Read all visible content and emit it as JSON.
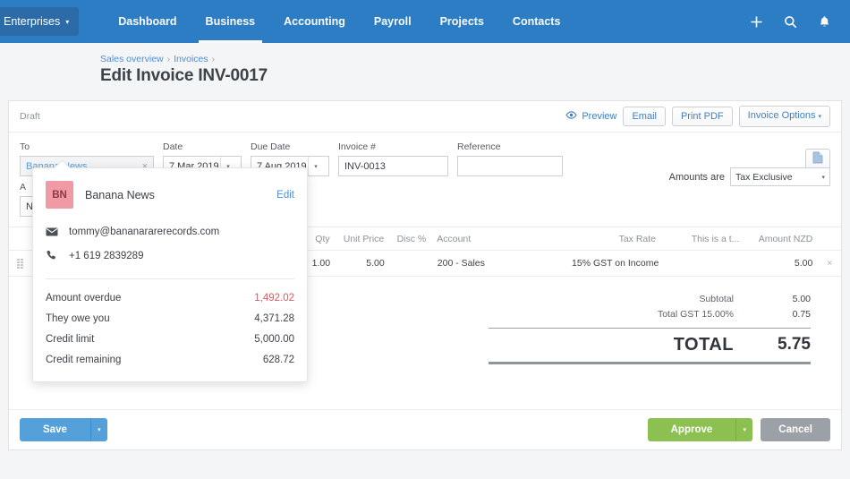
{
  "topnav": {
    "org": "Enterprises",
    "org_caret": "▾",
    "items": [
      {
        "label": "Dashboard",
        "active": false
      },
      {
        "label": "Business",
        "active": true
      },
      {
        "label": "Accounting",
        "active": false
      },
      {
        "label": "Payroll",
        "active": false
      },
      {
        "label": "Projects",
        "active": false
      },
      {
        "label": "Contacts",
        "active": false
      }
    ],
    "icons": [
      "plus-icon",
      "search-icon",
      "bell-icon"
    ]
  },
  "breadcrumb": {
    "item1": "Sales overview",
    "sep1": "›",
    "item2": "Invoices",
    "sep2": "›"
  },
  "page_title": "Edit Invoice INV-0017",
  "toolbar": {
    "status": "Draft",
    "preview": "Preview",
    "email": "Email",
    "print_pdf": "Print PDF",
    "invoice_options": "Invoice Options",
    "caret": "▾"
  },
  "form": {
    "to_label": "To",
    "to_value": "Banana News",
    "to_clear": "×",
    "date_label": "Date",
    "date_value": "7 Mar 2019",
    "due_label": "Due Date",
    "due_value": "7 Aug 2019",
    "invoice_label": "Invoice #",
    "invoice_value": "INV-0013",
    "reference_label": "Reference",
    "reference_value": "",
    "reference_placeholder": "",
    "caret": "▾",
    "hidden_label_a": "A",
    "hidden_value_m": "N",
    "amounts_are_label": "Amounts are",
    "amounts_are_value": "Tax Exclusive"
  },
  "table": {
    "headers": {
      "description": "",
      "qty": "Qty",
      "unit_price": "Unit Price",
      "disc": "Disc %",
      "account": "Account",
      "tax_rate": "Tax Rate",
      "tracking": "This is a t...",
      "amount": "Amount NZD"
    },
    "rows": [
      {
        "description": "",
        "qty": "1.00",
        "unit_price": "5.00",
        "disc": "",
        "account": "200 - Sales",
        "tax_rate": "15% GST on Income",
        "tracking": "",
        "amount": "5.00",
        "delete": "×"
      }
    ]
  },
  "totals": {
    "subtotal_label": "Subtotal",
    "subtotal_value": "5.00",
    "gst_label": "Total GST 15.00%",
    "gst_value": "0.75",
    "total_label": "TOTAL",
    "total_value": "5.75"
  },
  "contact_popup": {
    "initials": "BN",
    "name": "Banana News",
    "edit": "Edit",
    "email": "tommy@bananararerecords.com",
    "phone": "+1 619 2839289",
    "finance": [
      {
        "label": "Amount overdue",
        "value": "1,492.02",
        "negative": true
      },
      {
        "label": "They owe you",
        "value": "4,371.28",
        "negative": false
      },
      {
        "label": "Credit limit",
        "value": "5,000.00",
        "negative": false
      },
      {
        "label": "Credit remaining",
        "value": "628.72",
        "negative": false
      }
    ]
  },
  "footer": {
    "save": "Save",
    "approve": "Approve",
    "cancel": "Cancel",
    "caret": "▾"
  },
  "colors": {
    "nav_blue": "#2d7dc5",
    "accent_link": "#4a90d9",
    "save_blue": "#53a0da",
    "approve_green": "#8cc152",
    "cancel_gray": "#9ba1a6",
    "overdue_red": "#e0555f",
    "avatar_pink": "#ef9aa4"
  }
}
